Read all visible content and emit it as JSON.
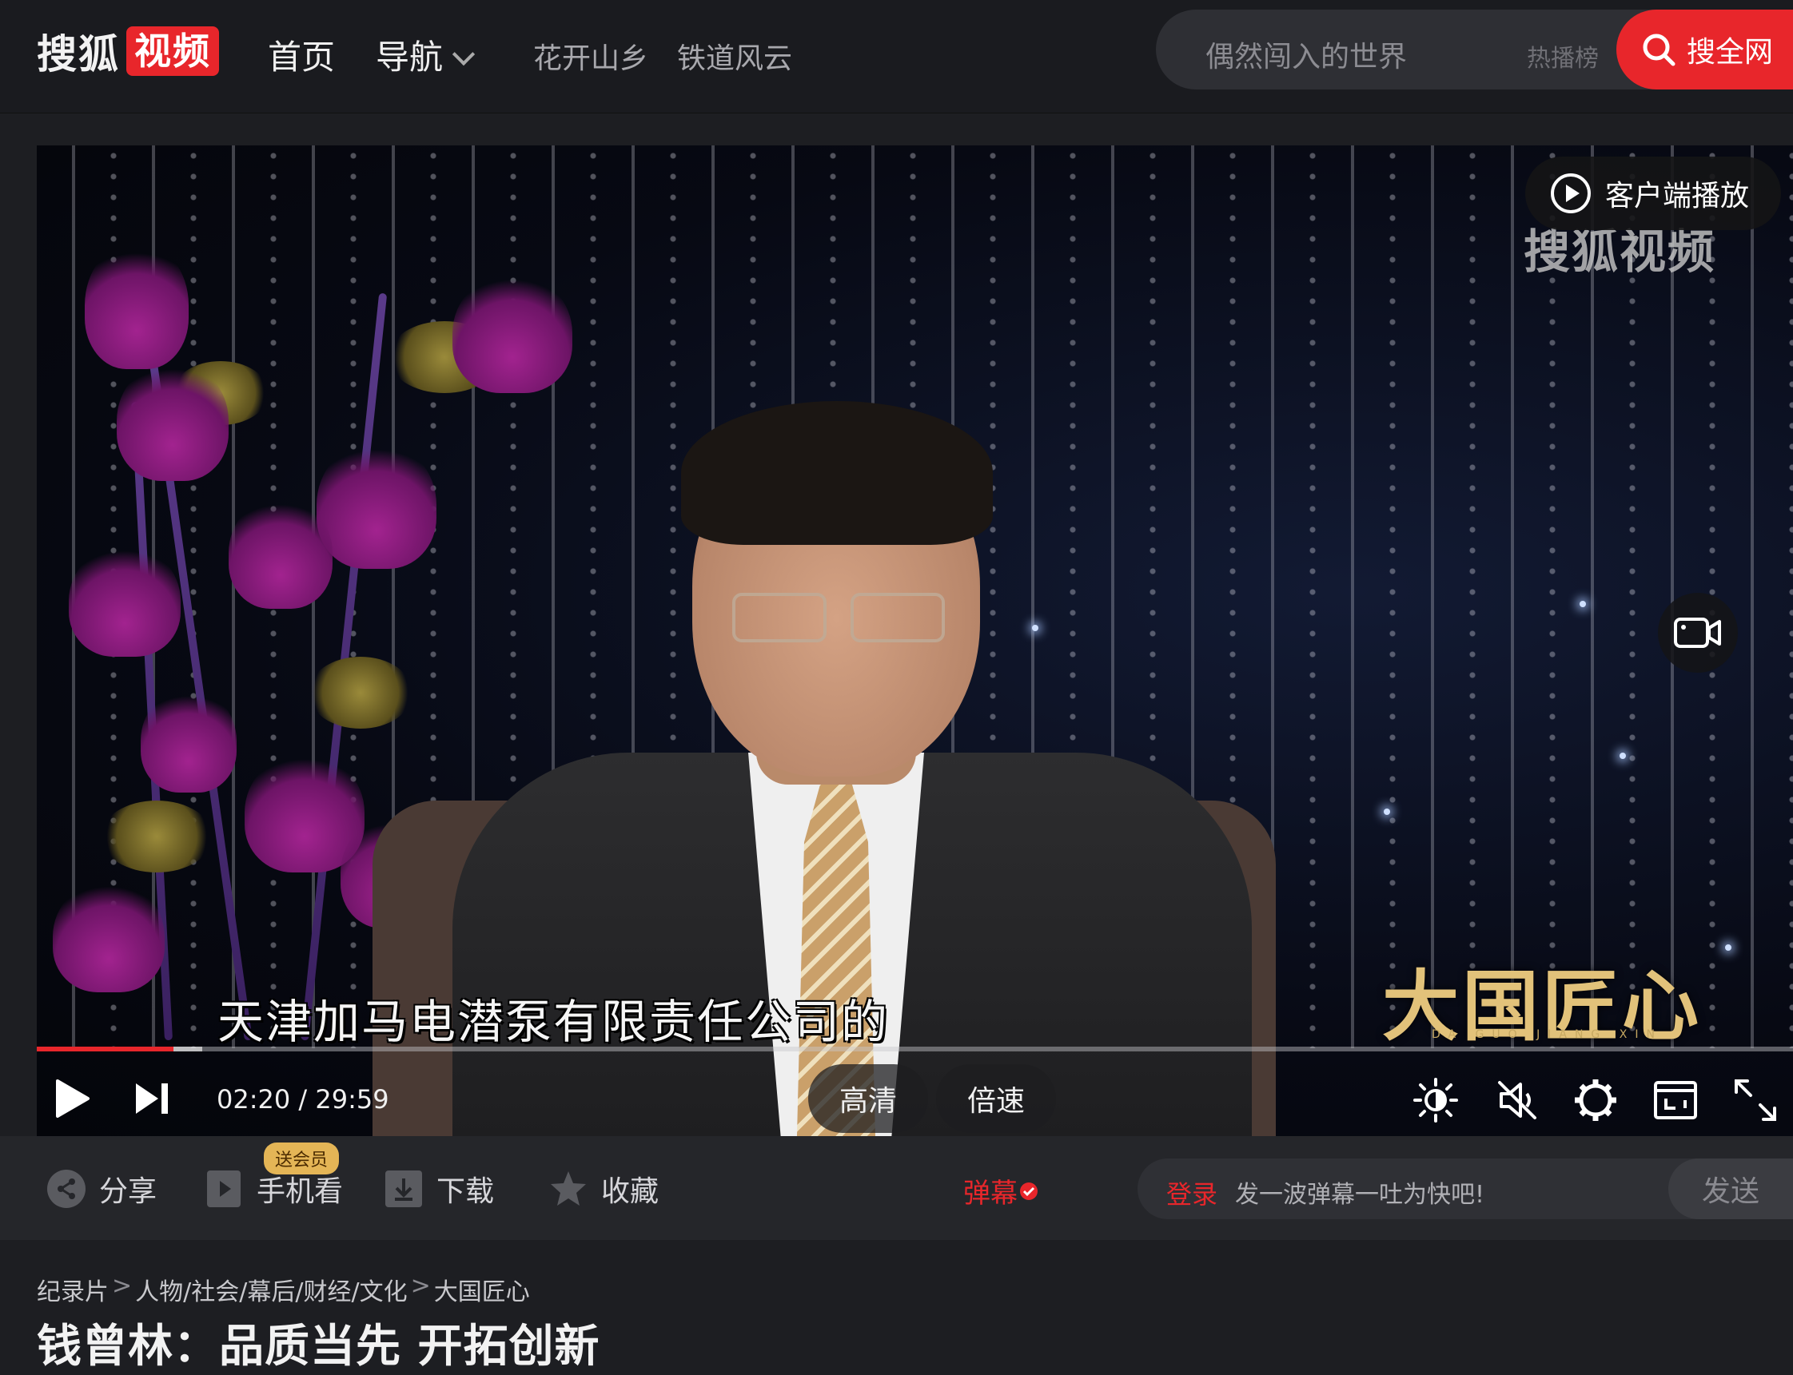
{
  "header": {
    "logo_text": "搜狐",
    "logo_badge": "视频",
    "nav_home": "首页",
    "nav_guide": "导航",
    "nav_links": [
      "花开山乡",
      "铁道风云"
    ],
    "search_placeholder": "偶然闯入的世界",
    "hot_rank": "热播榜",
    "search_button": "搜全网"
  },
  "player": {
    "client_play": "客户端播放",
    "channel_watermark": "搜狐视频",
    "show_logo": "大国匠心",
    "show_logo_pinyin": "DA GUO JIANG XIN",
    "subtitle": "天津加马电潜泵有限责任公司的",
    "current_time": "02:20",
    "duration": "29:59",
    "time_separator": " / ",
    "progress_played_fraction": 0.078,
    "progress_buffered_fraction": 0.016,
    "quality": "高清",
    "speed": "倍速",
    "icons": [
      "play-icon",
      "next-icon",
      "brightness-icon",
      "mute-icon",
      "settings-icon",
      "picture-in-picture-icon",
      "fullscreen-icon",
      "video-camera-icon"
    ]
  },
  "actions": {
    "share": "分享",
    "mobile": "手机看",
    "vip_badge": "送会员",
    "download": "下载",
    "favorite": "收藏",
    "danmu": "弹幕",
    "danmu_login": "登录",
    "danmu_placeholder": "发一波弹幕一吐为快吧!",
    "danmu_send": "发送"
  },
  "info": {
    "breadcrumb": [
      "纪录片",
      "人物/社会/幕后/财经/文化",
      "大国匠心"
    ],
    "title": "钱曾林：品质当先 开拓创新"
  },
  "colors": {
    "accent": "#e8262b",
    "background": "#1d1e22",
    "vip": "#e4b556"
  }
}
